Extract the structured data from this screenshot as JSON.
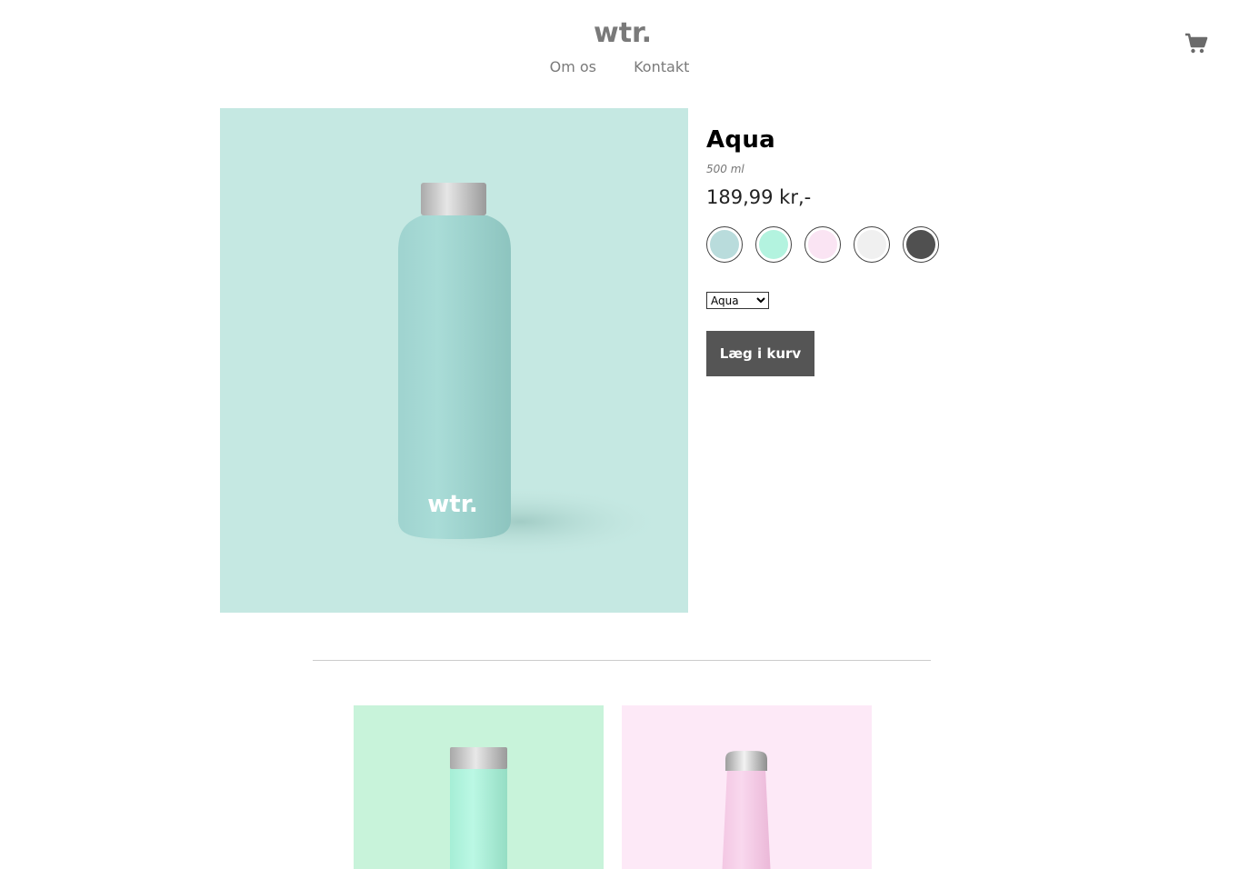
{
  "header": {
    "logo_text": "wtr.",
    "nav": [
      {
        "label": "Om os"
      },
      {
        "label": "Kontakt"
      }
    ]
  },
  "product": {
    "image_logo_text": "wtr.",
    "title": "Aqua",
    "volume": "500 ml",
    "price": "189,99 kr,-",
    "swatches": [
      {
        "name": "aqua",
        "color": "#b9dcdc"
      },
      {
        "name": "mint",
        "color": "#b3f3df"
      },
      {
        "name": "pink",
        "color": "#fae4f3"
      },
      {
        "name": "white",
        "color": "#f0f0f0"
      },
      {
        "name": "dark",
        "color": "#505050"
      }
    ],
    "select_value": "Aqua",
    "add_to_cart_label": "Læg i kurv"
  },
  "related": [
    {
      "name": "mint",
      "background": "#c8f3da"
    },
    {
      "name": "pink",
      "background": "#fde9f7"
    }
  ]
}
